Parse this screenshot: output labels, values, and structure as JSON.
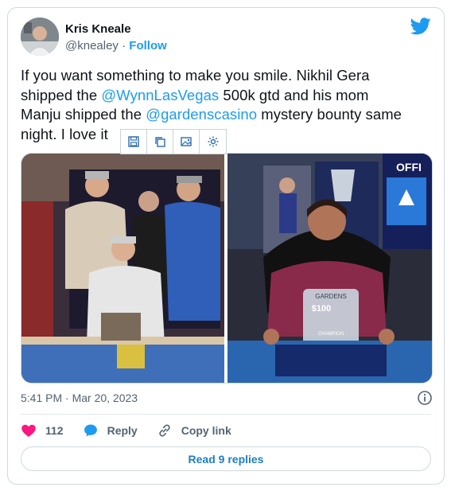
{
  "author": {
    "name": "Kris Kneale",
    "handle": "@knealey",
    "separator": " · ",
    "follow_label": "Follow"
  },
  "tweet": {
    "line1": "If you want something to make you smile. Nikhil Gera",
    "line2_pre": "shipped the ",
    "mention1": "@WynnLasVegas",
    "line2_post": " 500k gtd and his mom",
    "line3_pre": "Manju shipped the ",
    "mention2": "@gardenscasino",
    "line3_post": " mystery bounty same",
    "line4": "night. I love it"
  },
  "photo_right": {
    "plaque_top": "GARDENS",
    "plaque_amount": "$100",
    "plaque_bottom": "CHAMPION",
    "banner_text": "OFFI"
  },
  "toolbar": {
    "icons": [
      "save-icon",
      "copy-icon",
      "image-icon",
      "settings-icon"
    ]
  },
  "timestamp": "5:41 PM · Mar 20, 2023",
  "actions": {
    "like_count": "112",
    "reply_label": "Reply",
    "copy_link_label": "Copy link"
  },
  "read_replies_label": "Read 9 replies",
  "colors": {
    "accent": "#1d9bf0",
    "like": "#f91880",
    "text": "#0f1419",
    "muted": "#536471"
  }
}
